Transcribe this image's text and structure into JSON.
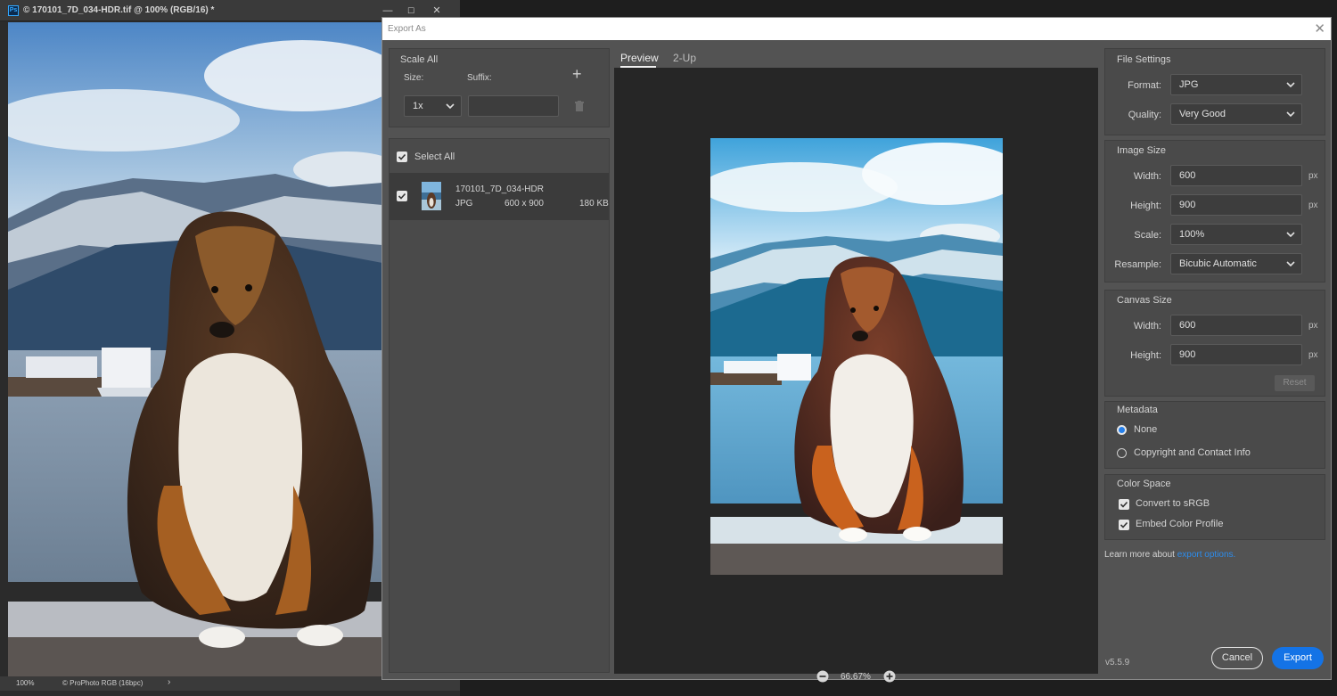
{
  "document": {
    "title": "© 170101_7D_034-HDR.tif @ 100% (RGB/16) *",
    "ps_logo": "Ps",
    "status_zoom": "100%",
    "status_profile": "© ProPhoto RGB (16bpc)",
    "status_arrow": "›",
    "window_buttons": {
      "minimize": "—",
      "maximize": "☐",
      "close": "✕"
    }
  },
  "dialog": {
    "title": "Export As",
    "close": "✕",
    "scale_all": {
      "heading": "Scale All",
      "size_label": "Size:",
      "suffix_label": "Suffix:",
      "size_value": "1x",
      "suffix_value": "",
      "add": "+"
    },
    "assets": {
      "select_all": "Select All",
      "items": [
        {
          "name": "170101_7D_034-HDR",
          "format": "JPG",
          "dimensions": "600 x 900",
          "size": "180 KB"
        }
      ]
    },
    "tabs": [
      "Preview",
      "2-Up"
    ],
    "zoom": "66.67%",
    "file_settings": {
      "heading": "File Settings",
      "format_label": "Format:",
      "format_value": "JPG",
      "quality_label": "Quality:",
      "quality_value": "Very Good"
    },
    "image_size": {
      "heading": "Image Size",
      "width_label": "Width:",
      "width_value": "600",
      "height_label": "Height:",
      "height_value": "900",
      "scale_label": "Scale:",
      "scale_value": "100%",
      "resample_label": "Resample:",
      "resample_value": "Bicubic Automatic",
      "unit": "px"
    },
    "canvas_size": {
      "heading": "Canvas Size",
      "width_label": "Width:",
      "width_value": "600",
      "height_label": "Height:",
      "height_value": "900",
      "unit": "px",
      "reset": "Reset"
    },
    "metadata": {
      "heading": "Metadata",
      "options": [
        "None",
        "Copyright and Contact Info"
      ],
      "selected": "None"
    },
    "color_space": {
      "heading": "Color Space",
      "convert_srgb": "Convert to sRGB",
      "embed_profile": "Embed Color Profile"
    },
    "learn_more_text": "Learn more about",
    "learn_more_link": "export options.",
    "version": "v5.5.9",
    "cancel": "Cancel",
    "export": "Export",
    "colors": {
      "accent": "#1473e6",
      "link": "#2d8ceb",
      "panel": "#4a4a4a",
      "dialog": "#535353",
      "preview_bg": "#262626"
    }
  }
}
